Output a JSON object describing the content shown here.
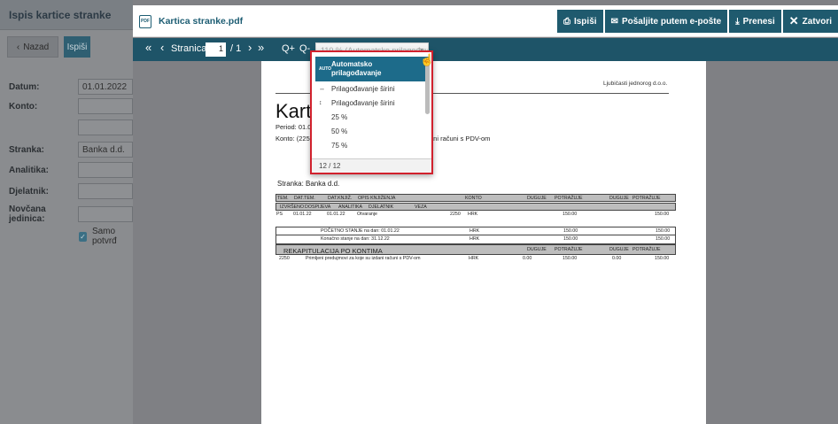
{
  "left_panel": {
    "title": "Ispis kartice stranke",
    "back_label": "Nazad",
    "print_label": "Ispiši",
    "fields": [
      {
        "label": "Datum:",
        "value": "01.01.2022"
      },
      {
        "label": "Konto:",
        "value": ""
      },
      {
        "label": "Stranka:",
        "value": "Banka d.d."
      },
      {
        "label": "Analitika:",
        "value": ""
      },
      {
        "label": "Djelatnik:",
        "value": ""
      },
      {
        "label": "Novčana jedinica:",
        "value": ""
      }
    ],
    "checkbox_label": "Samo potvrđ"
  },
  "viewer": {
    "file_badge": "PDF",
    "title": "Kartica stranke.pdf",
    "buttons": {
      "print": "Ispiši",
      "email": "Pošaljite putem e-pošte",
      "download": "Prenesi",
      "close": "Zatvori"
    },
    "toolbar": {
      "first": "«",
      "prev": "‹",
      "page_label": "Stranica:",
      "page_value": "1",
      "page_total": "/ 1",
      "next": "›",
      "last": "»",
      "zoom_in": "Q+",
      "zoom_out": "Q-",
      "zoom_value": "110 % (Automatsko prilagođav..."
    },
    "zoom_menu": {
      "items": [
        {
          "icon": "AUTO",
          "label": "Automatsko prilagođavanje"
        },
        {
          "icon": "↔",
          "label": "Prilagođavanje širini"
        },
        {
          "icon": "↕",
          "label": "Prilagođavanje širini"
        },
        {
          "icon": "",
          "label": "25 %"
        },
        {
          "icon": "",
          "label": "50 %"
        },
        {
          "icon": "",
          "label": "75 %"
        }
      ],
      "footer": "12 / 12"
    }
  },
  "document": {
    "company": "Ljubičasti jednorog d.o.o.",
    "heading": "Karti",
    "period": "Period: 01.0",
    "konto": "Konto: (225",
    "konto_tail": "ani računi s PDV-om",
    "stranka": "Stranka: Banka d.d.",
    "header1": [
      "TEM.",
      "DAT.TEM.",
      "DAT.KNJIŽ.",
      "OPIS KNJIŽENJA",
      "KONTO",
      "DUGUJE",
      "POTRAŽUJE",
      "DUGUJE",
      "POTRAŽUJE"
    ],
    "header2": [
      "IZVRŠENO",
      "DOSPIJEVA",
      "ANALITIKA",
      "DJELATNIK",
      "VEZA"
    ],
    "row": [
      "PS",
      "01.01.22",
      "01.01.22",
      "Otvaranje",
      "2250",
      "HRK",
      "150.00",
      "150.00"
    ],
    "start_balance": {
      "label": "POČETNO STANJE na dan: 01.01.22",
      "currency": "HRK",
      "a": "150.00",
      "b": "150.00"
    },
    "end_balance": {
      "label": "Konačno stanje na dan: 31.12.22",
      "currency": "HRK",
      "a": "150.00",
      "b": "150.00"
    },
    "recap": {
      "title": "REKAPITULACIJA PO KONTIMA",
      "cols": [
        "DUGUJE",
        "POTRAŽUJE",
        "DUGUJE",
        "POTRAŽUJE"
      ],
      "row": [
        "2250",
        "Primljeni predujmovi za koje su izdani računi s PDV-om",
        "HRK",
        "0.00",
        "150.00",
        "0.00",
        "150.00"
      ]
    }
  }
}
